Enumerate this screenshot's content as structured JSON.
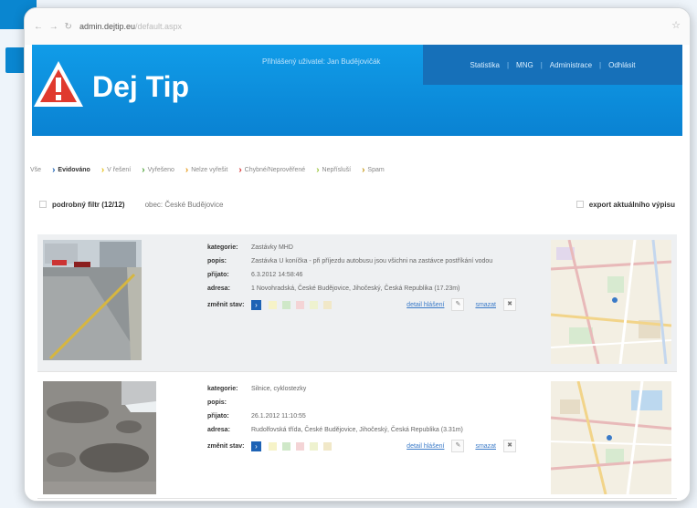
{
  "browser": {
    "nav_glyphs": "← → ↻",
    "url_domain": "admin.dejtip.eu",
    "url_path": "/default.aspx",
    "star": "☆"
  },
  "header": {
    "brand": "Dej Tip",
    "welcome": "Přihlášený uživatel: Jan Budějovičák",
    "nav": [
      "Statistika",
      "MNG",
      "Administrace",
      "Odhlásit"
    ],
    "nav_separator": "|"
  },
  "tabs": {
    "first": "Vše",
    "chev": "›",
    "items": [
      {
        "label": "Evidováno",
        "color": "#1e63b5"
      },
      {
        "label": "V řešení",
        "color": "#e7c21a"
      },
      {
        "label": "Vyřešeno",
        "color": "#4fa43a"
      },
      {
        "label": "Nelze vyřešit",
        "color": "#e79a1a"
      },
      {
        "label": "Chybné/Neprověřené",
        "color": "#d83535"
      },
      {
        "label": "Nepřísluší",
        "color": "#9bc53d"
      },
      {
        "label": "Spam",
        "color": "#c79a1a"
      }
    ]
  },
  "filter": {
    "label": "podrobný filtr (12/12)",
    "obec": "obec: České Budějovice",
    "export": "export aktuálního výpisu"
  },
  "labels": {
    "category": "kategorie:",
    "description": "popis:",
    "received": "přijato:",
    "address": "adresa:",
    "status": "změnit stav:",
    "detail": "detail hlášení",
    "delete": "smazat",
    "active_status": "›",
    "pencil": "✎",
    "trash": "✖"
  },
  "status_colors": [
    "#1e63b5",
    "#f6f3c8",
    "#cfe8c8",
    "#f4d4d6",
    "#eef2cf",
    "#f1e8c8"
  ],
  "reports": [
    {
      "category": "Zastávky MHD",
      "description": "Zastávka U koníčka - při příjezdu autobusu jsou všichni na zastávce postříkání vodou",
      "received": "6.3.2012 14:58:46",
      "address": "1 Novohradská, České Budějovice, Jihočeský, Česká Republika (17.23m)"
    },
    {
      "category": "Silnice, cyklostezky",
      "description": "",
      "received": "26.1.2012 11:10:55",
      "address": "Rudolfovská třída, České Budějovice, Jihočeský, Česká Republika (3.31m)"
    }
  ]
}
